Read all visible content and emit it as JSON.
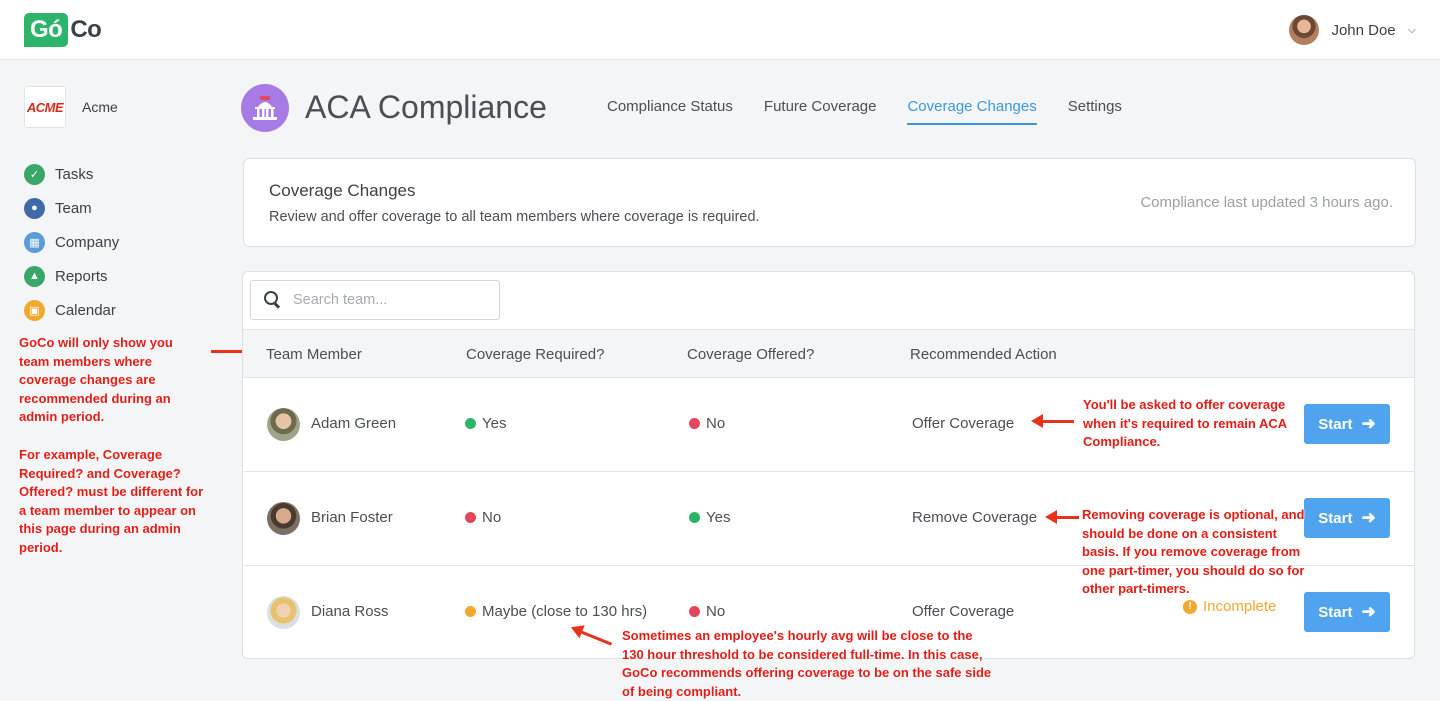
{
  "topbar": {
    "logo_go": "Gó",
    "logo_co": "Co",
    "user_name": "John Doe"
  },
  "company": {
    "logo_text": "ACME",
    "name": "Acme"
  },
  "nav": {
    "items": [
      {
        "label": "Tasks",
        "icon": "check-circle-icon",
        "color": "#3aa667"
      },
      {
        "label": "Team",
        "icon": "team-icon",
        "color": "#3f6aa8"
      },
      {
        "label": "Company",
        "icon": "building-icon",
        "color": "#5b9bd8"
      },
      {
        "label": "Reports",
        "icon": "reports-icon",
        "color": "#3aa667"
      },
      {
        "label": "Calendar",
        "icon": "calendar-icon",
        "color": "#f0a92e"
      }
    ]
  },
  "page": {
    "title": "ACA Compliance",
    "icon": "capitol-building-icon",
    "tabs": [
      {
        "label": "Compliance Status",
        "active": false
      },
      {
        "label": "Future Coverage",
        "active": false
      },
      {
        "label": "Coverage Changes",
        "active": true
      },
      {
        "label": "Settings",
        "active": false
      }
    ]
  },
  "summary_card": {
    "heading": "Coverage Changes",
    "description": "Review and offer coverage to all team members where coverage is required.",
    "updated": "Compliance last updated 3 hours ago."
  },
  "table": {
    "search_placeholder": "Search team...",
    "columns": [
      "Team Member",
      "Coverage Required?",
      "Coverage Offered?",
      "Recommended Action"
    ],
    "rows": [
      {
        "name": "Adam Green",
        "required": "Yes",
        "required_color": "#2db46b",
        "offered": "No",
        "offered_color": "#e4475a",
        "action": "Offer Coverage",
        "status": "",
        "button": "Start"
      },
      {
        "name": "Brian Foster",
        "required": "No",
        "required_color": "#e4475a",
        "offered": "Yes",
        "offered_color": "#2db46b",
        "action": "Remove Coverage",
        "status": "",
        "button": "Start"
      },
      {
        "name": "Diana Ross",
        "required": "Maybe (close to 130 hrs)",
        "required_color": "#f0a92e",
        "offered": "No",
        "offered_color": "#e4475a",
        "action": "Offer Coverage",
        "status": "Incomplete",
        "button": "Start"
      }
    ]
  },
  "annotations": {
    "left_note_1": "GoCo will only show you team members where coverage changes are recommended during an admin period.",
    "left_note_2": "For example, Coverage Required? and Coverage? Offered? must be different for a team member to appear on this page during an admin period.",
    "row1_note": "You'll be asked to offer coverage when it's required to remain ACA Compliance.",
    "row2_note": "Removing coverage is optional, and should be done on a consistent basis.  If you remove coverage from one part-timer, you should do so for other part-timers.",
    "row3_note": "Sometimes an employee's hourly avg will be close to the 130 hour threshold to be considered full-time.  In this case, GoCo recommends offering coverage to be on the safe side of being compliant."
  }
}
